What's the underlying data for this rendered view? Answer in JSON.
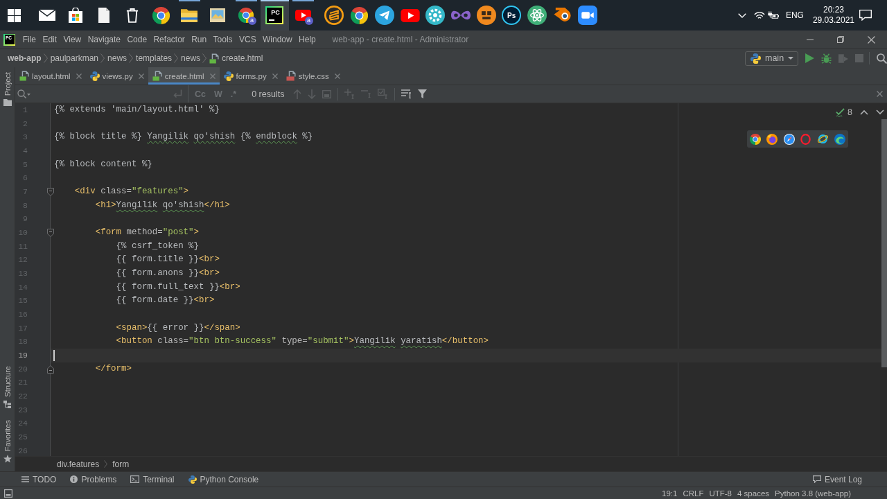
{
  "taskbar": {
    "apps": [
      {
        "kind": "start",
        "running": false,
        "selected": false
      },
      {
        "kind": "mail",
        "running": false,
        "selected": false
      },
      {
        "kind": "store",
        "running": false,
        "selected": false
      },
      {
        "kind": "file",
        "running": false,
        "selected": false
      },
      {
        "kind": "trash",
        "running": false,
        "selected": false
      },
      {
        "kind": "chrome",
        "running": false,
        "selected": false
      },
      {
        "kind": "explorer",
        "running": true,
        "selected": false
      },
      {
        "kind": "photos",
        "running": false,
        "selected": false
      },
      {
        "kind": "chrome",
        "running": true,
        "selected": false,
        "badge": "a"
      },
      {
        "kind": "pycharm",
        "running": true,
        "selected": true,
        "label": "PC"
      },
      {
        "kind": "youtube",
        "running": true,
        "selected": false,
        "badge": "a"
      },
      {
        "kind": "sublime",
        "running": false,
        "selected": false
      },
      {
        "kind": "chrome",
        "running": false,
        "selected": false
      },
      {
        "kind": "telegram",
        "running": false,
        "selected": false
      },
      {
        "kind": "youtube",
        "running": false,
        "selected": false
      },
      {
        "kind": "gear",
        "running": false,
        "selected": false
      },
      {
        "kind": "studio",
        "running": false,
        "selected": false
      },
      {
        "kind": "robot",
        "running": false,
        "selected": false
      },
      {
        "kind": "photoshop",
        "running": false,
        "selected": false,
        "label": "Ps"
      },
      {
        "kind": "atom",
        "running": false,
        "selected": false
      },
      {
        "kind": "blender",
        "running": false,
        "selected": false
      },
      {
        "kind": "zoom",
        "running": false,
        "selected": false
      }
    ],
    "tray": {
      "language": "ENG",
      "time": "20:23",
      "date": "29.03.2021"
    }
  },
  "window": {
    "logo": "PC",
    "menu": [
      "File",
      "Edit",
      "View",
      "Navigate",
      "Code",
      "Refactor",
      "Run",
      "Tools",
      "VCS",
      "Window",
      "Help"
    ],
    "title": "web-app - create.html - Administrator"
  },
  "navigation": {
    "breadcrumbs": [
      {
        "label": "web-app",
        "kind": "project"
      },
      {
        "label": "paulparkman",
        "kind": "folder"
      },
      {
        "label": "news",
        "kind": "folder"
      },
      {
        "label": "templates",
        "kind": "folder"
      },
      {
        "label": "news",
        "kind": "folder"
      },
      {
        "label": "create.html",
        "kind": "html"
      }
    ],
    "run_config": "main",
    "actions": [
      {
        "kind": "run",
        "disabled": false
      },
      {
        "kind": "debug",
        "disabled": false
      },
      {
        "kind": "coverage",
        "disabled": true
      },
      {
        "kind": "stop",
        "disabled": true
      },
      {
        "kind": "search",
        "disabled": false
      }
    ]
  },
  "side_tabs": {
    "top": [
      {
        "label": "Project",
        "kind": "project"
      }
    ],
    "bottom": [
      {
        "label": "Structure",
        "kind": "structure"
      },
      {
        "label": "Favorites",
        "kind": "favorites"
      }
    ]
  },
  "tabs": [
    {
      "label": "layout.html",
      "kind": "html",
      "selected": false
    },
    {
      "label": "views.py",
      "kind": "python",
      "selected": false
    },
    {
      "label": "create.html",
      "kind": "html",
      "selected": true
    },
    {
      "label": "forms.py",
      "kind": "python",
      "selected": false
    },
    {
      "label": "style.css",
      "kind": "css",
      "selected": false
    }
  ],
  "find_bar": {
    "toggles": [
      {
        "label": "Cc",
        "selected": false
      },
      {
        "label": "W",
        "selected": false
      },
      {
        "label": ".*",
        "selected": false
      }
    ],
    "results": "0 results"
  },
  "editor": {
    "problems": "8",
    "lines": [
      {
        "number": "1",
        "selected": false,
        "fold_start": false,
        "fold_end": false,
        "tokens": [
          {
            "text": "{% extends 'main/layout.html' %}",
            "kind": "template",
            "typo": false
          }
        ]
      },
      {
        "number": "2",
        "selected": false,
        "fold_start": false,
        "fold_end": false
      },
      {
        "number": "3",
        "selected": false,
        "fold_start": false,
        "fold_end": false,
        "tokens": [
          {
            "text": "{% block title %}",
            "kind": "template",
            "typo": false
          },
          {
            "text": " Yangilik",
            "kind": "text",
            "typo": true
          },
          {
            "text": " qo'shish",
            "kind": "text",
            "typo": true
          },
          {
            "text": " {% ",
            "kind": "template",
            "typo": false
          },
          {
            "text": "endblock",
            "kind": "template",
            "typo": true
          },
          {
            "text": " %}",
            "kind": "template",
            "typo": false
          }
        ]
      },
      {
        "number": "4",
        "selected": false,
        "fold_start": false,
        "fold_end": false
      },
      {
        "number": "5",
        "selected": false,
        "fold_start": false,
        "fold_end": false,
        "tokens": [
          {
            "text": "{% block content %}",
            "kind": "template",
            "typo": false
          }
        ]
      },
      {
        "number": "6",
        "selected": false,
        "fold_start": false,
        "fold_end": false
      },
      {
        "number": "7",
        "selected": false,
        "fold_start": true,
        "fold_end": false,
        "tokens": [
          {
            "text": "    <div",
            "kind": "tag",
            "typo": false
          },
          {
            "text": " class=",
            "kind": "attr",
            "typo": false
          },
          {
            "text": "\"features\"",
            "kind": "value",
            "typo": false
          },
          {
            "text": ">",
            "kind": "tag",
            "typo": false
          }
        ]
      },
      {
        "number": "8",
        "selected": false,
        "fold_start": false,
        "fold_end": false,
        "tokens": [
          {
            "text": "        <h1>",
            "kind": "tag",
            "typo": false
          },
          {
            "text": "Yangilik",
            "kind": "text",
            "typo": true
          },
          {
            "text": " qo'shish",
            "kind": "text",
            "typo": true
          },
          {
            "text": "</h1>",
            "kind": "tag",
            "typo": false
          }
        ]
      },
      {
        "number": "9",
        "selected": false,
        "fold_start": false,
        "fold_end": false
      },
      {
        "number": "10",
        "selected": false,
        "fold_start": true,
        "fold_end": false,
        "tokens": [
          {
            "text": "        <form",
            "kind": "tag",
            "typo": false
          },
          {
            "text": " method=",
            "kind": "attr",
            "typo": false
          },
          {
            "text": "\"post\"",
            "kind": "value",
            "typo": false
          },
          {
            "text": ">",
            "kind": "tag",
            "typo": false
          }
        ]
      },
      {
        "number": "11",
        "selected": false,
        "fold_start": false,
        "fold_end": false,
        "tokens": [
          {
            "text": "            {% csrf_token %}",
            "kind": "template",
            "typo": false
          }
        ]
      },
      {
        "number": "12",
        "selected": false,
        "fold_start": false,
        "fold_end": false,
        "tokens": [
          {
            "text": "            {{ form.title }}",
            "kind": "template",
            "typo": false
          },
          {
            "text": "<br>",
            "kind": "tag",
            "typo": false
          }
        ]
      },
      {
        "number": "13",
        "selected": false,
        "fold_start": false,
        "fold_end": false,
        "tokens": [
          {
            "text": "            {{ form.anons }}",
            "kind": "template",
            "typo": false
          },
          {
            "text": "<br>",
            "kind": "tag",
            "typo": false
          }
        ]
      },
      {
        "number": "14",
        "selected": false,
        "fold_start": false,
        "fold_end": false,
        "tokens": [
          {
            "text": "            {{ form.full_text }}",
            "kind": "template",
            "typo": false
          },
          {
            "text": "<br>",
            "kind": "tag",
            "typo": false
          }
        ]
      },
      {
        "number": "15",
        "selected": false,
        "fold_start": false,
        "fold_end": false,
        "tokens": [
          {
            "text": "            {{ form.date }}",
            "kind": "template",
            "typo": false
          },
          {
            "text": "<br>",
            "kind": "tag",
            "typo": false
          }
        ]
      },
      {
        "number": "16",
        "selected": false,
        "fold_start": false,
        "fold_end": false
      },
      {
        "number": "17",
        "selected": false,
        "fold_start": false,
        "fold_end": false,
        "tokens": [
          {
            "text": "            <span>",
            "kind": "tag",
            "typo": false
          },
          {
            "text": "{{ error }}",
            "kind": "template",
            "typo": false
          },
          {
            "text": "</span>",
            "kind": "tag",
            "typo": false
          }
        ]
      },
      {
        "number": "18",
        "selected": false,
        "fold_start": false,
        "fold_end": false,
        "tokens": [
          {
            "text": "            <button",
            "kind": "tag",
            "typo": false
          },
          {
            "text": " class=",
            "kind": "attr",
            "typo": false
          },
          {
            "text": "\"btn btn-success\"",
            "kind": "value",
            "typo": false
          },
          {
            "text": " type=",
            "kind": "attr",
            "typo": false
          },
          {
            "text": "\"submit\"",
            "kind": "value",
            "typo": false
          },
          {
            "text": ">",
            "kind": "tag",
            "typo": false
          },
          {
            "text": "Yangilik",
            "kind": "text",
            "typo": true
          },
          {
            "text": " yaratish",
            "kind": "text",
            "typo": true
          },
          {
            "text": "</button>",
            "kind": "tag",
            "typo": false
          }
        ]
      },
      {
        "number": "19",
        "selected": true,
        "fold_start": false,
        "fold_end": false
      },
      {
        "number": "20",
        "selected": false,
        "fold_start": false,
        "fold_end": true,
        "tokens": [
          {
            "text": "        </form>",
            "kind": "tag",
            "typo": false
          }
        ]
      },
      {
        "number": "21",
        "selected": false,
        "fold_start": false,
        "fold_end": false
      },
      {
        "number": "22",
        "selected": false,
        "fold_start": false,
        "fold_end": false
      },
      {
        "number": "23",
        "selected": false,
        "fold_start": false,
        "fold_end": false
      },
      {
        "number": "24",
        "selected": false,
        "fold_start": false,
        "fold_end": false
      },
      {
        "number": "25",
        "selected": false,
        "fold_start": false,
        "fold_end": false
      },
      {
        "number": "26",
        "selected": false,
        "fold_start": false,
        "fold_end": false
      }
    ]
  },
  "editor_breadcrumbs": [
    "div.features",
    "form"
  ],
  "tool_windows": {
    "left": [
      {
        "label": "TODO",
        "kind": "todo"
      },
      {
        "label": "Problems",
        "kind": "problems"
      },
      {
        "label": "Terminal",
        "kind": "terminal"
      },
      {
        "label": "Python Console",
        "kind": "python"
      }
    ],
    "right": [
      {
        "label": "Event Log",
        "kind": "log"
      }
    ]
  },
  "status_bar": {
    "items": [
      "19:1",
      "CRLF",
      "UTF-8",
      "4 spaces",
      "Python 3.8 (web-app)"
    ]
  }
}
